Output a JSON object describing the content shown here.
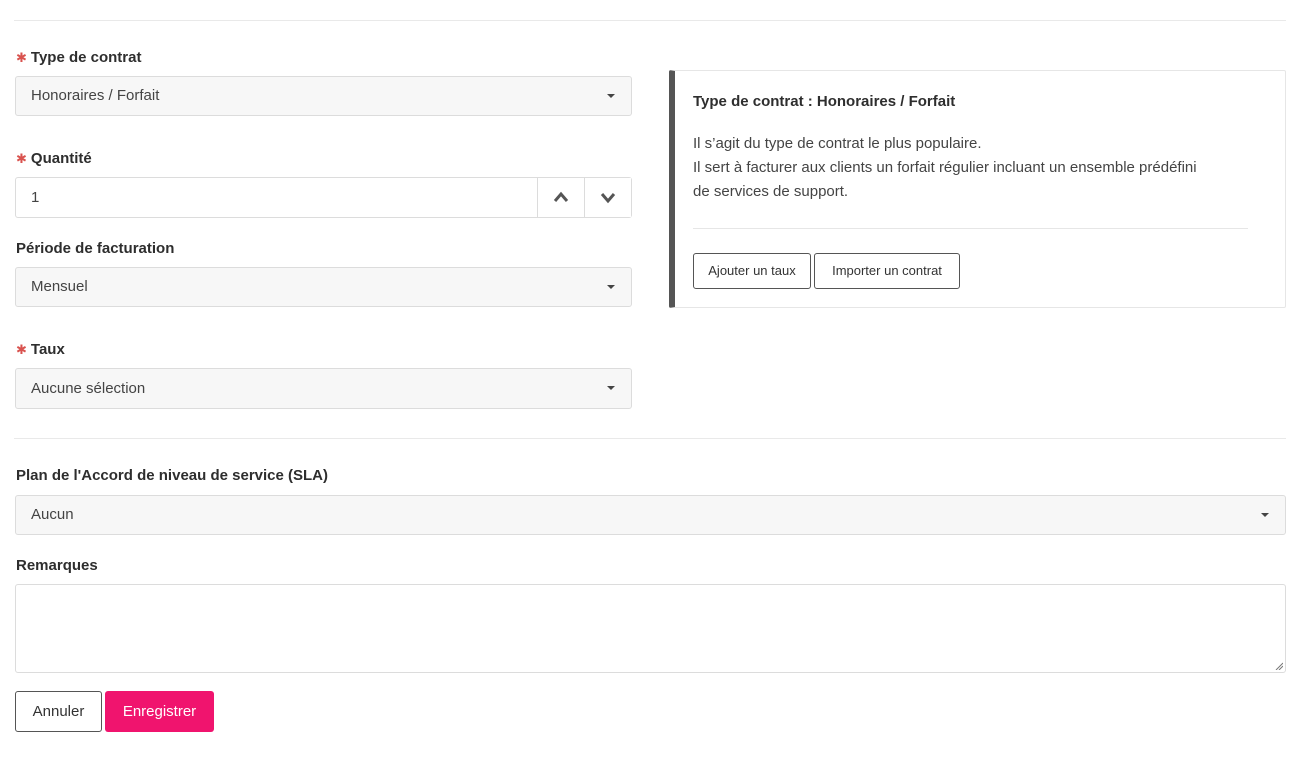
{
  "form": {
    "contract_type": {
      "label": "Type de contrat",
      "value": "Honoraires / Forfait",
      "required_mark": "✱"
    },
    "quantity": {
      "label": "Quantité",
      "value": "1",
      "required_mark": "✱"
    },
    "billing_period": {
      "label": "Période de facturation",
      "value": "Mensuel"
    },
    "rate": {
      "label": "Taux",
      "value": "Aucune sélection",
      "required_mark": "✱"
    },
    "sla": {
      "label": "Plan de l'Accord de niveau de service (SLA)",
      "value": "Aucun"
    },
    "notes": {
      "label": "Remarques",
      "value": ""
    }
  },
  "info_panel": {
    "title": "Type de contrat : Honoraires / Forfait",
    "lines": [
      "Il s’agit du type de contrat le plus populaire.",
      "Il sert à facturer aux clients un forfait régulier incluant un ensemble prédéfini",
      "de services de support."
    ],
    "add_rate_label": "Ajouter un taux",
    "import_contract_label": "Importer un contrat"
  },
  "actions": {
    "cancel_label": "Annuler",
    "save_label": "Enregistrer"
  },
  "colors": {
    "accent": "#f0146e",
    "required": "#d9534f",
    "panel_border": "#555555"
  },
  "icons": {
    "increment": "chevron-up-icon",
    "decrement": "chevron-down-icon",
    "select": "caret-down-icon"
  }
}
